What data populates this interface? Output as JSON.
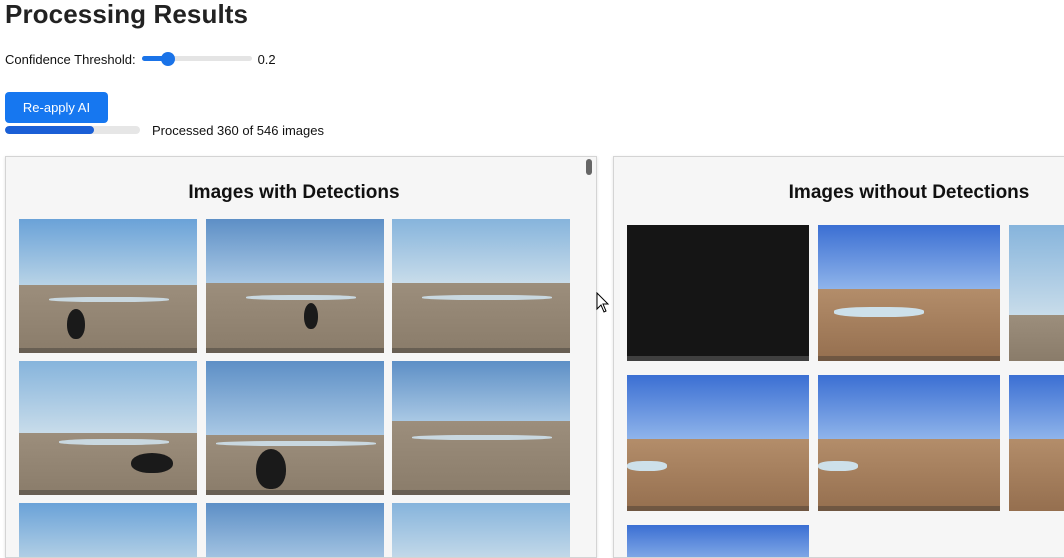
{
  "header": {
    "title": "Processing Results"
  },
  "threshold": {
    "label": "Confidence Threshold:",
    "value": "0.2",
    "fraction": 0.2
  },
  "actions": {
    "reapply_label": "Re-apply AI"
  },
  "progress": {
    "text": "Processed 360 of 546 images",
    "processed": 360,
    "total": 546
  },
  "panels": {
    "with_detections": {
      "title": "Images with Detections"
    },
    "without_detections": {
      "title": "Images without Detections"
    }
  },
  "colors": {
    "accent": "#1677f0",
    "progress": "#1a5fd6"
  }
}
